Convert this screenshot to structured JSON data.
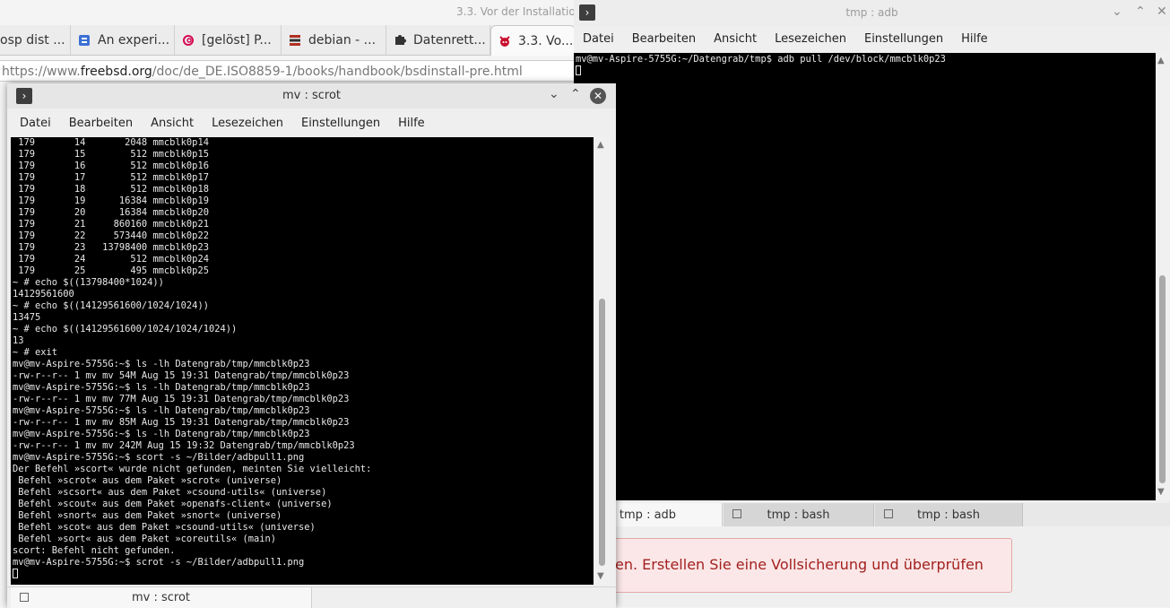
{
  "browser": {
    "window_title": "3.3. Vor der Installatio",
    "tabs": [
      {
        "label": "osp dist ...",
        "icon": "none"
      },
      {
        "label": "An experi...",
        "icon": "blogger-icon",
        "color": "#3b6fd6"
      },
      {
        "label": "[gelöst] P...",
        "icon": "debian-swirl-icon",
        "color": "#d70a53"
      },
      {
        "label": "debian - ...",
        "icon": "stack-icon",
        "color": "#b03020"
      },
      {
        "label": "Datenrett...",
        "icon": "puzzle-icon",
        "color": "#333333"
      },
      {
        "label": "3.3. Vo...",
        "icon": "freebsd-icon",
        "color": "#c8102e"
      }
    ],
    "url_prefix": "https://www.",
    "url_domain": "freebsd.org",
    "url_path": "/doc/de_DE.ISO8859-1/books/handbook/bsdinstall-pre.html",
    "alert_text": "en. Erstellen Sie eine Vollsicherung und überprüfen"
  },
  "konsole_adb": {
    "title": "tmp : adb",
    "menu": [
      "Datei",
      "Bearbeiten",
      "Ansicht",
      "Lesezeichen",
      "Einstellungen",
      "Hilfe"
    ],
    "terminal_text": "mv@mv-Aspire-5755G:~/Datengrab/tmp$ adb pull /dev/block/mmcblk0p23",
    "tabs": [
      "tmp : adb",
      "tmp : bash",
      "tmp : bash"
    ]
  },
  "konsole_scrot": {
    "title": "mv : scrot",
    "menu": [
      "Datei",
      "Bearbeiten",
      "Ansicht",
      "Lesezeichen",
      "Einstellungen",
      "Hilfe"
    ],
    "terminal_text": " 179       14       2048 mmcblk0p14\n 179       15        512 mmcblk0p15\n 179       16        512 mmcblk0p16\n 179       17        512 mmcblk0p17\n 179       18        512 mmcblk0p18\n 179       19      16384 mmcblk0p19\n 179       20      16384 mmcblk0p20\n 179       21     860160 mmcblk0p21\n 179       22     573440 mmcblk0p22\n 179       23   13798400 mmcblk0p23\n 179       24        512 mmcblk0p24\n 179       25        495 mmcblk0p25\n~ # echo $((13798400*1024))\n14129561600\n~ # echo $((14129561600/1024/1024))\n13475\n~ # echo $((14129561600/1024/1024/1024))\n13\n~ # exit\nmv@mv-Aspire-5755G:~$ ls -lh Datengrab/tmp/mmcblk0p23\n-rw-r--r-- 1 mv mv 54M Aug 15 19:31 Datengrab/tmp/mmcblk0p23\nmv@mv-Aspire-5755G:~$ ls -lh Datengrab/tmp/mmcblk0p23\n-rw-r--r-- 1 mv mv 77M Aug 15 19:31 Datengrab/tmp/mmcblk0p23\nmv@mv-Aspire-5755G:~$ ls -lh Datengrab/tmp/mmcblk0p23\n-rw-r--r-- 1 mv mv 85M Aug 15 19:31 Datengrab/tmp/mmcblk0p23\nmv@mv-Aspire-5755G:~$ ls -lh Datengrab/tmp/mmcblk0p23\n-rw-r--r-- 1 mv mv 242M Aug 15 19:32 Datengrab/tmp/mmcblk0p23\nmv@mv-Aspire-5755G:~$ scort -s ~/Bilder/adbpull1.png\nDer Befehl »scort« wurde nicht gefunden, meinten Sie vielleicht:\n Befehl »scrot« aus dem Paket »scrot« (universe)\n Befehl »scsort« aus dem Paket »csound-utils« (universe)\n Befehl »scout« aus dem Paket »openafs-client« (universe)\n Befehl »snort« aus dem Paket »snort« (universe)\n Befehl »scot« aus dem Paket »csound-utils« (universe)\n Befehl »sort« aus dem Paket »coreutils« (main)\nscort: Befehl nicht gefunden.\nmv@mv-Aspire-5755G:~$ scrot -s ~/Bilder/adbpull1.png",
    "tabs": [
      "mv : scrot"
    ]
  }
}
